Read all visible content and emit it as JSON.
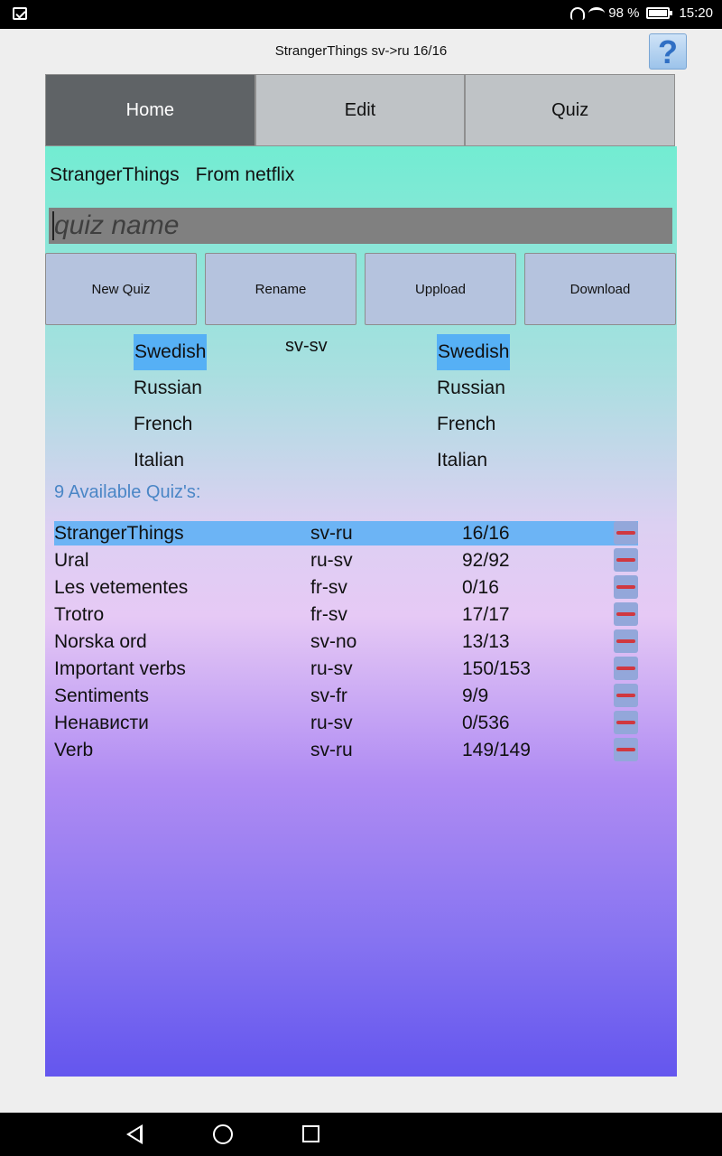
{
  "status_bar": {
    "battery": "98 %",
    "time": "15:20"
  },
  "title_bar": {
    "title": "StrangerThings sv->ru 16/16",
    "help": "?"
  },
  "tabs": [
    {
      "label": "Home",
      "active": true
    },
    {
      "label": "Edit",
      "active": false
    },
    {
      "label": "Quiz",
      "active": false
    }
  ],
  "quiz_info": {
    "name": "StrangerThings",
    "description": "From netflix"
  },
  "name_input": {
    "placeholder": "quiz name",
    "value": ""
  },
  "buttons": {
    "new_quiz": "New Quiz",
    "rename": "Rename",
    "upload": "Uppload",
    "download": "Download"
  },
  "language_pair": "sv-sv",
  "source_languages": [
    "Swedish",
    "Russian",
    "French",
    "Italian"
  ],
  "target_languages": [
    "Swedish",
    "Russian",
    "French",
    "Italian"
  ],
  "selected_source": "Swedish",
  "selected_target": "Swedish",
  "available_label": "9 Available Quiz's:",
  "quizzes": [
    {
      "name": "StrangerThings",
      "pair": "sv-ru",
      "score": "16/16",
      "selected": true
    },
    {
      "name": "Ural",
      "pair": "ru-sv",
      "score": "92/92",
      "selected": false
    },
    {
      "name": "Les vetementes",
      "pair": "fr-sv",
      "score": "0/16",
      "selected": false
    },
    {
      "name": "Trotro",
      "pair": "fr-sv",
      "score": "17/17",
      "selected": false
    },
    {
      "name": "Norska ord",
      "pair": "sv-no",
      "score": "13/13",
      "selected": false
    },
    {
      "name": "Important verbs",
      "pair": "ru-sv",
      "score": "150/153",
      "selected": false
    },
    {
      "name": "Sentiments",
      "pair": "sv-fr",
      "score": "9/9",
      "selected": false
    },
    {
      "name": "Ненависти",
      "pair": "ru-sv",
      "score": "0/536",
      "selected": false
    },
    {
      "name": "Verb",
      "pair": "sv-ru",
      "score": "149/149",
      "selected": false
    }
  ],
  "colors": {
    "accent": "#56b0f5",
    "active_tab": "#5f6366",
    "delete": "#d03840"
  }
}
